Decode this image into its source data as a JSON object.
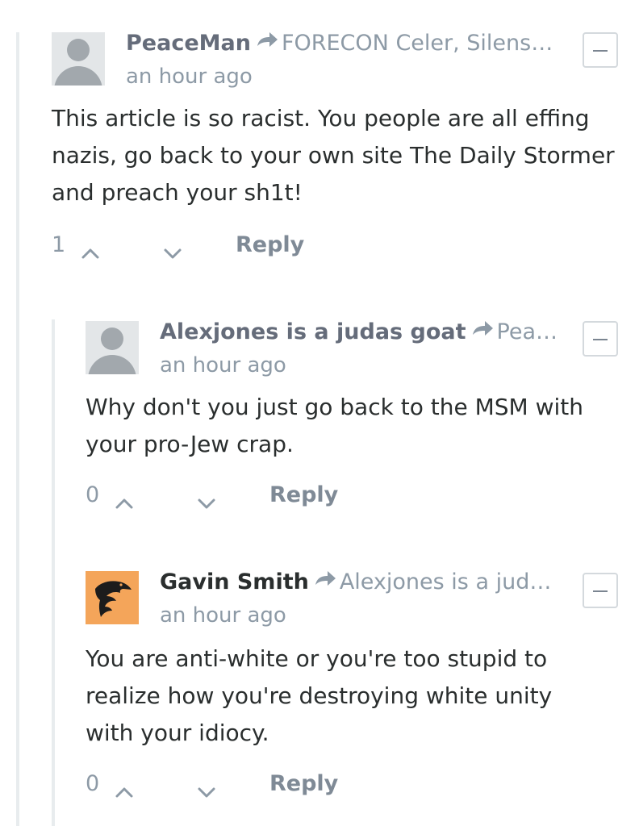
{
  "comments": [
    {
      "author": "PeaceMan",
      "reply_to": "FORECON Celer, Silens…",
      "time": "an hour ago",
      "message": "This article is so racist. You people are all effing nazis, go back to your own site The Daily Stormer and preach your sh1t!",
      "votes": "1",
      "reply_label": "Reply",
      "avatar_icon": "default-user-avatar"
    },
    {
      "author": "Alexjones is a judas goat",
      "reply_to": "Pea…",
      "time": "an hour ago",
      "message": "Why don't you just go back to the MSM with your pro-Jew crap.",
      "votes": "0",
      "reply_label": "Reply",
      "avatar_icon": "default-user-avatar"
    },
    {
      "author": "Gavin Smith",
      "reply_to": "Alexjones is a jud…",
      "time": "an hour ago",
      "message": "You are anti-white or you're too stupid to realize how you're destroying white unity with your idiocy.",
      "votes": "0",
      "reply_label": "Reply",
      "avatar_icon": "eagle-avatar"
    }
  ],
  "colors": {
    "author": "#656c7a",
    "author_dark": "#2a2e2e",
    "meta": "#8d9aa6",
    "body": "#2a2e2e",
    "eagle_bg": "#f4a55a",
    "thread_line": "#e8ecee"
  }
}
